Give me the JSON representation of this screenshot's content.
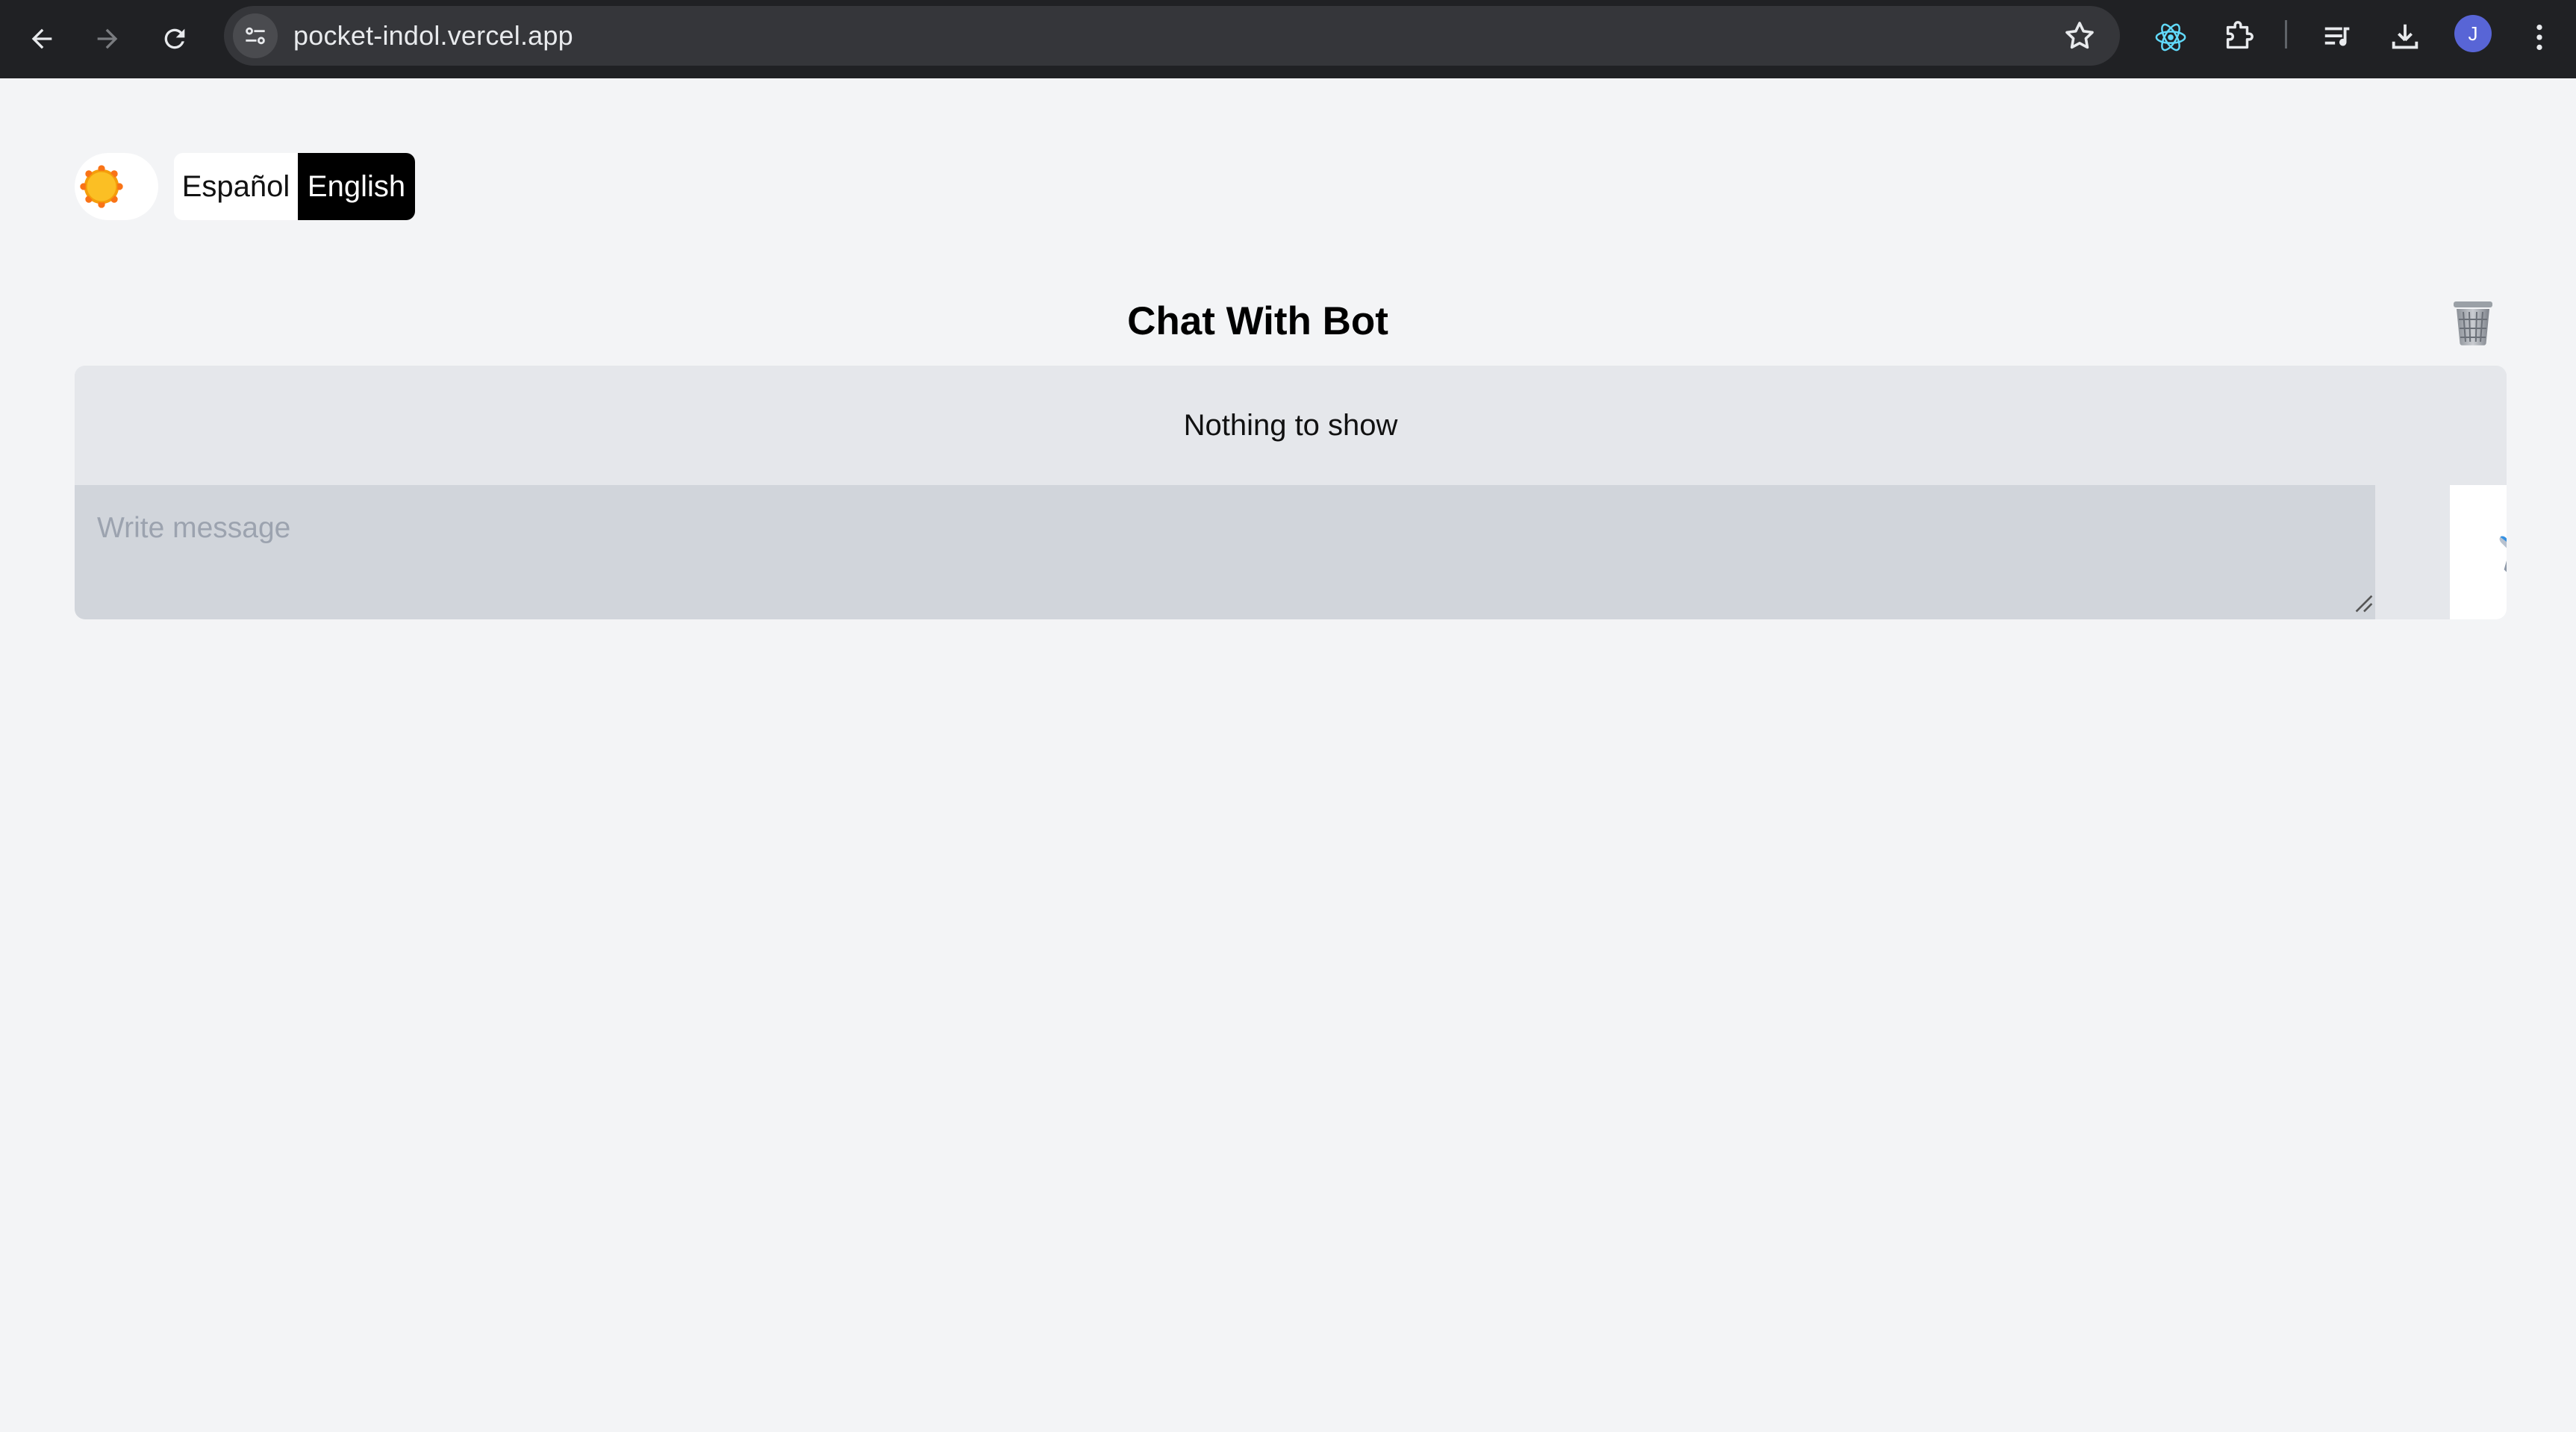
{
  "browser": {
    "url": "pocket-indol.vercel.app",
    "avatar_initial": "J",
    "icons": [
      "back-arrow-icon",
      "forward-arrow-icon",
      "reload-icon",
      "site-info-icon",
      "bookmark-star-icon",
      "react-devtools-icon",
      "extensions-puzzle-icon",
      "media-queue-icon",
      "download-icon",
      "kebab-menu-icon"
    ]
  },
  "header": {
    "theme_icon": "sun-icon",
    "languages": [
      {
        "label": "Español",
        "selected": false
      },
      {
        "label": "English",
        "selected": true
      }
    ]
  },
  "chat": {
    "title": "Chat With Bot",
    "clear_icon": "trash-can-icon",
    "empty_state": "Nothing to show",
    "input_placeholder": "Write message",
    "input_value": "",
    "send_icon": "airplane-icon"
  },
  "colors": {
    "page_background": "#f3f4f6",
    "messages_background": "#e5e7eb",
    "input_background": "#d1d5db",
    "selected_language_bg": "#000000"
  }
}
